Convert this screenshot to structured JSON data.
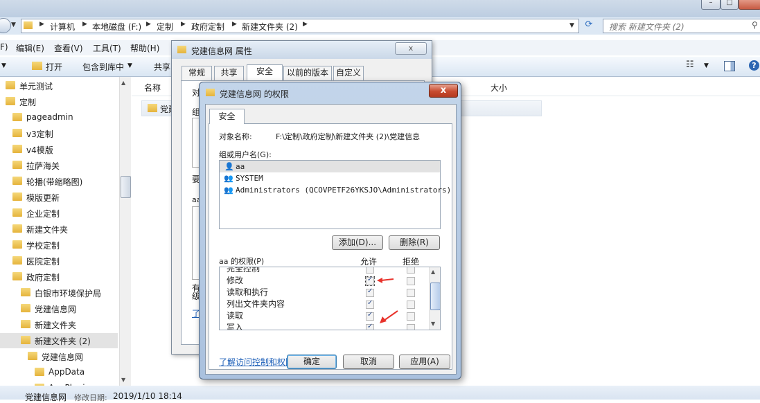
{
  "explorer": {
    "address": {
      "crumbs": [
        "计算机",
        "本地磁盘 (F:)",
        "定制",
        "政府定制",
        "新建文件夹 (2)"
      ],
      "search_placeholder": "搜索 新建文件夹 (2)"
    },
    "menu": {
      "file_partial": "F)",
      "edit": "编辑(E)",
      "view": "查看(V)",
      "tools": "工具(T)",
      "help": "帮助(H)"
    },
    "toolbar": {
      "open": "打开",
      "include": "包含到库中",
      "share_partial": "共享"
    },
    "nav_items": [
      {
        "label": "单元测试",
        "level": 0
      },
      {
        "label": "定制",
        "level": 0
      },
      {
        "label": "pageadmin",
        "level": 1
      },
      {
        "label": "v3定制",
        "level": 1
      },
      {
        "label": "v4模版",
        "level": 1
      },
      {
        "label": "拉萨海关",
        "level": 1
      },
      {
        "label": "轮播(带缩略图)",
        "level": 1
      },
      {
        "label": "模版更新",
        "level": 1
      },
      {
        "label": "企业定制",
        "level": 1
      },
      {
        "label": "新建文件夹",
        "level": 1
      },
      {
        "label": "学校定制",
        "level": 1
      },
      {
        "label": "医院定制",
        "level": 1
      },
      {
        "label": "政府定制",
        "level": 1
      },
      {
        "label": "白银市环境保护局",
        "level": 2
      },
      {
        "label": "党建信息网",
        "level": 2
      },
      {
        "label": "新建文件夹",
        "level": 2
      },
      {
        "label": "新建文件夹 (2)",
        "level": 2,
        "selected": true
      },
      {
        "label": "党建信息网",
        "level": 3
      },
      {
        "label": "AppData",
        "level": 4
      },
      {
        "label": "AppPlugi",
        "level": 4
      }
    ],
    "columns": {
      "name": "名称",
      "size": "大小"
    },
    "file_partial": "党建",
    "status": {
      "name": "党建信息网",
      "modified_label": "修改日期:",
      "modified_value": "2019/1/10 18:14"
    }
  },
  "props_dialog": {
    "title": "党建信息网 属性",
    "tabs": [
      "常规",
      "共享",
      "安全",
      "以前的版本",
      "自定义"
    ],
    "active_tab": "安全",
    "partial_left": [
      "对",
      "组",
      "要",
      "aa",
      "有",
      "级",
      "了"
    ]
  },
  "perm_dialog": {
    "title": "党建信息网 的权限",
    "tab": "安全",
    "object_label": "对象名称:",
    "object_value": "F:\\定制\\政府定制\\新建文件夹 (2)\\党建信息",
    "group_label": "组或用户名(G):",
    "users": [
      "aa",
      "SYSTEM",
      "Administrators (QCOVPETF26YKSJO\\Administrators)"
    ],
    "add_button": "添加(D)...",
    "remove_button": "删除(R)",
    "perm_label": "aa 的权限(P)",
    "allow_label": "允许",
    "deny_label": "拒绝",
    "permissions": [
      {
        "name": "完全控制",
        "allow": false,
        "deny": false
      },
      {
        "name": "修改",
        "allow": true,
        "deny": false
      },
      {
        "name": "读取和执行",
        "allow": true,
        "deny": false
      },
      {
        "name": "列出文件夹内容",
        "allow": true,
        "deny": false
      },
      {
        "name": "读取",
        "allow": true,
        "deny": false
      },
      {
        "name": "写入",
        "allow": true,
        "deny": false
      }
    ],
    "link": "了解访问控制和权限",
    "ok": "确定",
    "cancel": "取消",
    "apply": "应用(A)",
    "close_glyph": "x",
    "accent_arrow": "#e8322b"
  }
}
